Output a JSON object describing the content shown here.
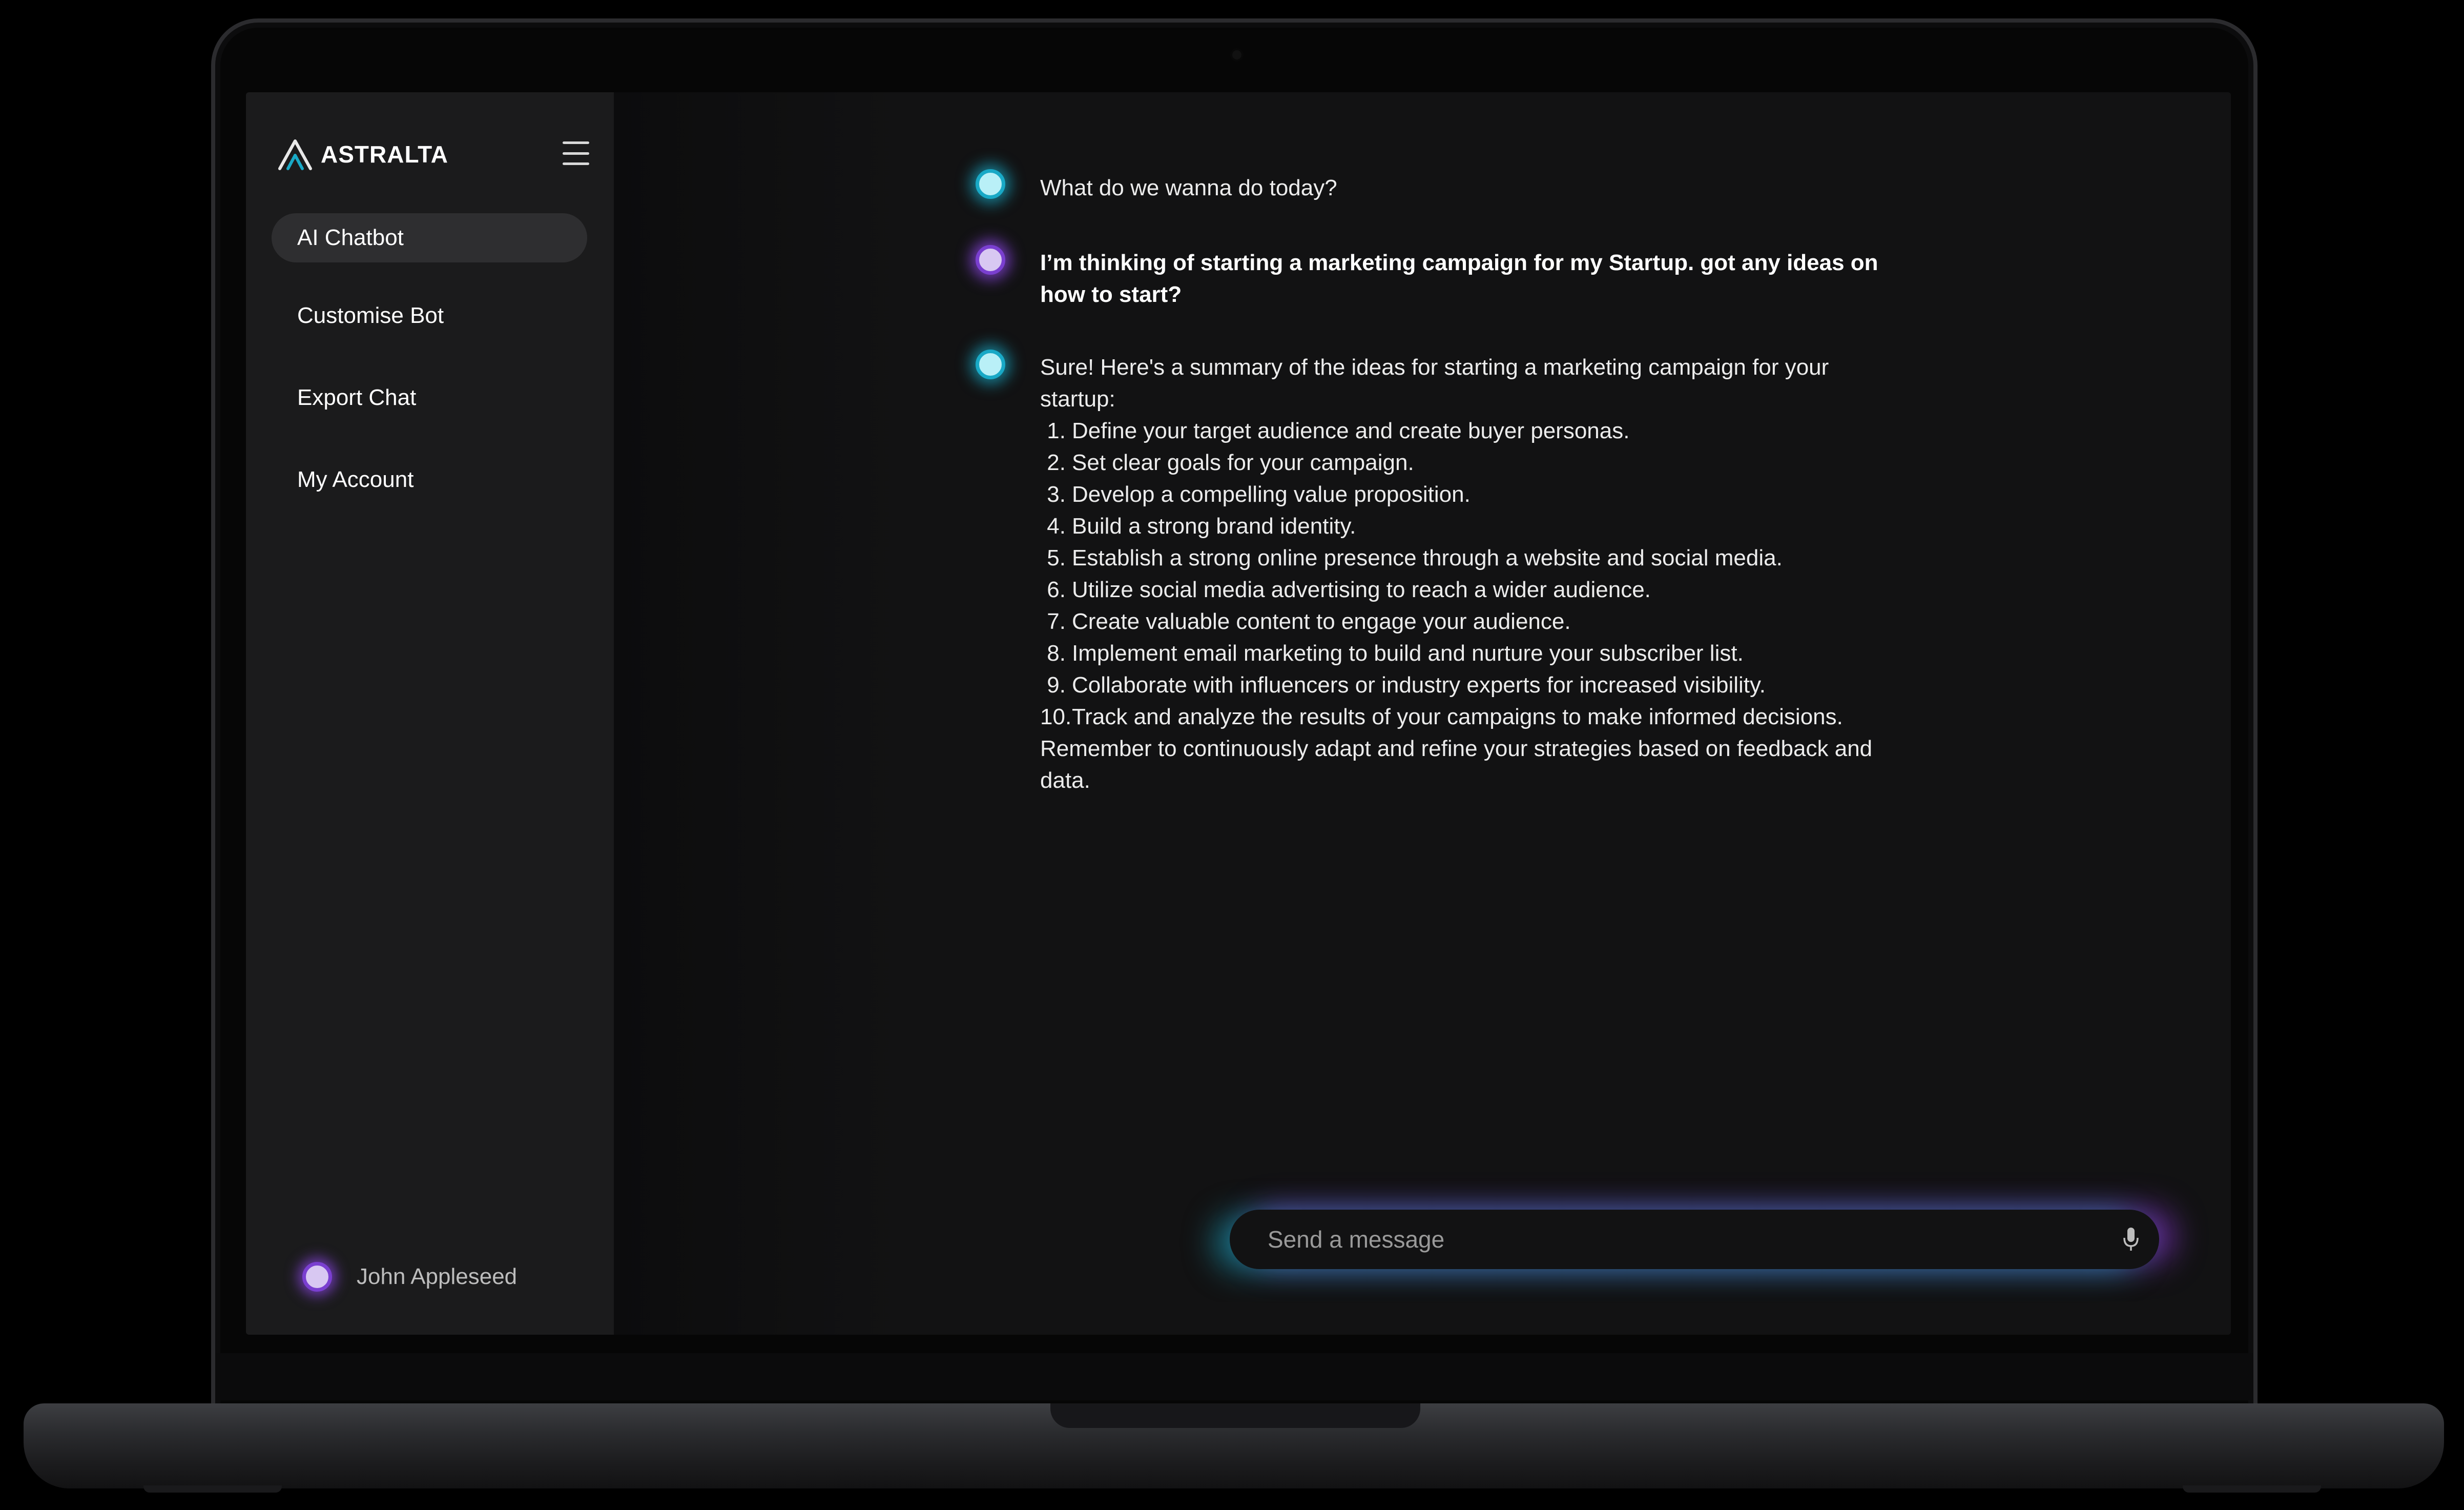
{
  "brand": {
    "name": "ASTRALTA",
    "logo_icon": "astralta-logo-icon",
    "accent": "#19a9c6"
  },
  "sidebar": {
    "menu_icon": "hamburger-menu-icon",
    "items": [
      {
        "label": "AI Chatbot",
        "active": true
      },
      {
        "label": "Customise Bot",
        "active": false
      },
      {
        "label": "Export Chat",
        "active": false
      },
      {
        "label": "My Account",
        "active": false
      }
    ],
    "user": {
      "name": "John Appleseed",
      "avatar_color": "#7a3fd0"
    }
  },
  "chat": {
    "messages": [
      {
        "role": "bot",
        "text": "What do we wanna do today?"
      },
      {
        "role": "user",
        "text": "I’m thinking of starting a marketing campaign for my Startup. got any ideas on how to start?"
      },
      {
        "role": "bot",
        "intro": "Sure! Here's a summary of the ideas for starting a marketing campaign for your startup:",
        "list": [
          {
            "num": "1.",
            "text": "Define your target audience and create buyer personas."
          },
          {
            "num": "2.",
            "text": "Set clear goals for your campaign."
          },
          {
            "num": "3.",
            "text": "Develop a compelling value proposition."
          },
          {
            "num": "4.",
            "text": "Build a strong brand identity."
          },
          {
            "num": "5.",
            "text": "Establish a strong online presence through a website and social media."
          },
          {
            "num": "6.",
            "text": "Utilize social media advertising to reach a wider audience."
          },
          {
            "num": "7.",
            "text": "Create valuable content to engage your audience."
          },
          {
            "num": "8.",
            "text": "Implement email marketing to build and nurture your subscriber list."
          },
          {
            "num": "9.",
            "text": "Collaborate with influencers or industry experts for increased visibility."
          },
          {
            "num": "10.",
            "text": "Track and analyze the results of your campaigns to make informed decisions."
          }
        ],
        "outro": "Remember to continuously adapt and refine your strategies based on feedback and data."
      }
    ],
    "bot_color": "#19a9c6",
    "user_color": "#7a3fd0"
  },
  "input": {
    "placeholder": "Send a message",
    "value": "",
    "mic_icon": "microphone-icon"
  }
}
